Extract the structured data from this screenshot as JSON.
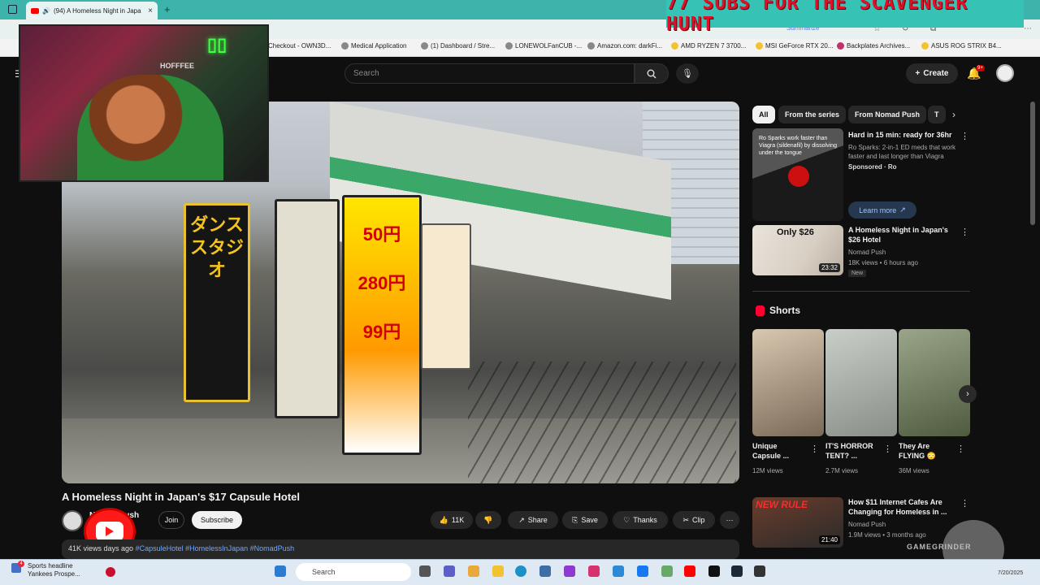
{
  "browser": {
    "tab_title": "(94) A Homeless Night in Japa",
    "new_tab": "+",
    "summarize": "Summarize",
    "bookmarks": [
      "Checkout - OWN3D...",
      "Medical Application",
      "(1) Dashboard / Stre...",
      "LONEWOLFanCUB -...",
      "Amazon.com: darkFi...",
      "AMD RYZEN 7 3700...",
      "MSI GeForce RTX 20...",
      "Backplates Archives...",
      "ASUS ROG STRIX B4..."
    ]
  },
  "overlay": {
    "subs_banner": "77 SUBS FOR THE SCAVENGER HUNT",
    "webcam_hat": "HOFFFEE",
    "watermark": "GAMEGRINDER"
  },
  "youtube": {
    "search_placeholder": "Search",
    "create_label": "Create",
    "notif_count": "9+",
    "video": {
      "title": "A Homeless Night in Japan's $17 Capsule Hotel",
      "channel": "Nomad Push",
      "subs": "subscribers",
      "join": "Join",
      "subscribe": "Subscribe",
      "likes": "11K",
      "share": "Share",
      "save": "Save",
      "thanks": "Thanks",
      "clip": "Clip",
      "desc_meta": "41K views  days ago",
      "desc_tags": "#CapsuleHotel #HomelessInJapan #NomadPush",
      "signs": [
        "ダンススタジオ",
        "50円",
        "280円",
        "99円"
      ]
    },
    "chips": [
      "All",
      "From the series",
      "From Nomad Push",
      "T"
    ],
    "ad": {
      "thumb_text": "Ro Sparks work faster than Viagra (sildenafil) by dissolving under the tongue",
      "title": "Hard in 15 min: ready for 36hr",
      "desc": "Ro Sparks: 2-in-1 ED meds that work faster and last longer than Viagra",
      "sponsored": "Sponsored",
      "advertiser": "Ro",
      "cta": "Learn more"
    },
    "rec1": {
      "thumb_label": "Only $26",
      "duration": "23:32",
      "title": "A Homeless Night in Japan's $26 Hotel",
      "channel": "Nomad Push",
      "meta": "18K views • 6 hours ago",
      "badge": "New"
    },
    "shorts_heading": "Shorts",
    "shorts": [
      {
        "title": "Unique Capsule ...",
        "views": "12M views"
      },
      {
        "title": "IT'S HORROR TENT? ...",
        "views": "2.7M views"
      },
      {
        "title": "They Are FLYING 😳",
        "views": "36M views"
      }
    ],
    "rec2": {
      "thumb_label": "NEW RULE",
      "duration": "21:40",
      "title": "How $11 Internet Cafes Are Changing for Homeless in ...",
      "channel": "Nomad Push",
      "meta": "1.9M views • 3 months ago"
    }
  },
  "taskbar": {
    "news_title": "Sports headline",
    "news_sub": "Yankees Prospe...",
    "news_badge": "4",
    "search": "Search",
    "date": "7/20/2025"
  }
}
